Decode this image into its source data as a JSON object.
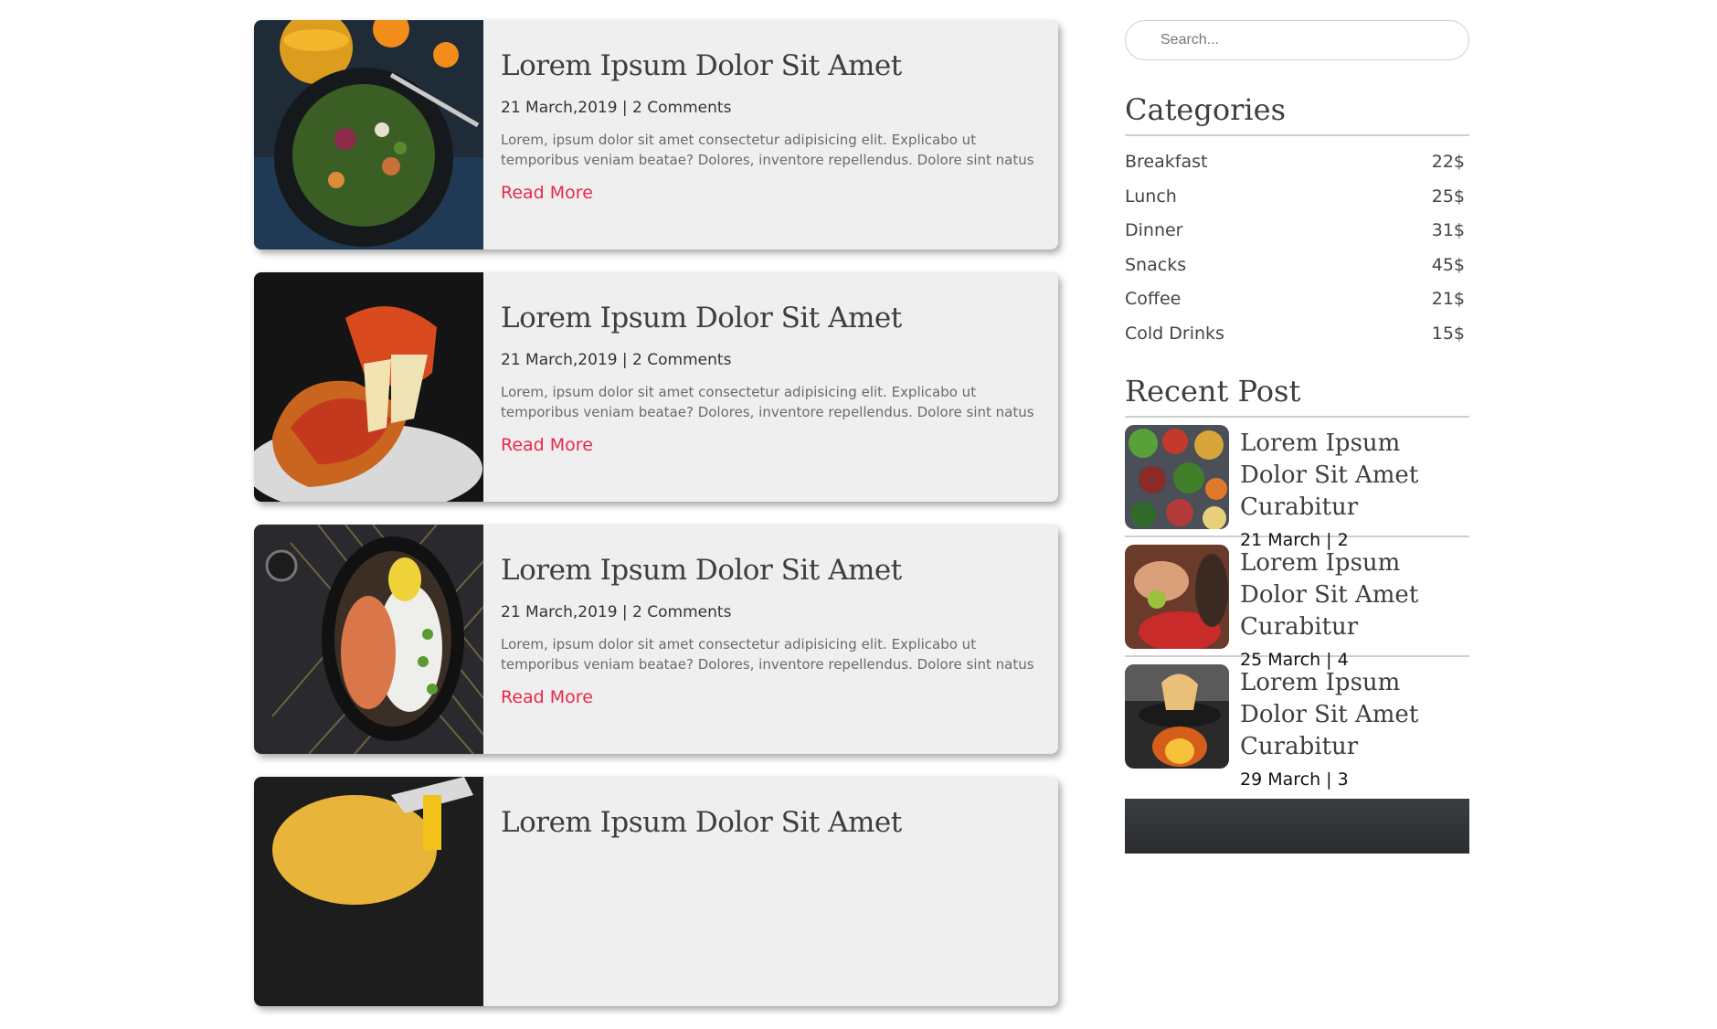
{
  "search": {
    "placeholder": "Search..."
  },
  "posts": [
    {
      "title": "Lorem Ipsum Dolor Sit Amet",
      "meta": "21 March,2019 | 2 Comments",
      "excerpt": "Lorem, ipsum dolor sit amet consectetur adipisicing elit. Explicabo ut temporibus veniam beatae? Dolores, inventore repellendus. Dolore sint natus",
      "read_more": "Read More",
      "image": "salad-photo"
    },
    {
      "title": "Lorem Ipsum Dolor Sit Amet",
      "meta": "21 March,2019 | 2 Comments",
      "excerpt": "Lorem, ipsum dolor sit amet consectetur adipisicing elit. Explicabo ut temporibus veniam beatae? Dolores, inventore repellendus. Dolore sint natus",
      "read_more": "Read More",
      "image": "pizza-photo"
    },
    {
      "title": "Lorem Ipsum Dolor Sit Amet",
      "meta": "21 March,2019 | 2 Comments",
      "excerpt": "Lorem, ipsum dolor sit amet consectetur adipisicing elit. Explicabo ut temporibus veniam beatae? Dolores, inventore repellendus. Dolore sint natus",
      "read_more": "Read More",
      "image": "shrimp-rice-bowl-photo"
    },
    {
      "title": "Lorem Ipsum Dolor Sit Amet",
      "image": "pasta-photo"
    }
  ],
  "categories": {
    "heading": "Categories",
    "items": [
      {
        "name": "Breakfast",
        "price": "22$"
      },
      {
        "name": "Lunch",
        "price": "25$"
      },
      {
        "name": "Dinner",
        "price": "31$"
      },
      {
        "name": "Snacks",
        "price": "45$"
      },
      {
        "name": "Coffee",
        "price": "21$"
      },
      {
        "name": "Cold Drinks",
        "price": "15$"
      }
    ]
  },
  "recent": {
    "heading": "Recent Post",
    "items": [
      {
        "title": "Lorem Ipsum Dolor Sit Amet Curabitur",
        "meta": "21 March | 2",
        "image": "vegetables-photo"
      },
      {
        "title": "Lorem Ipsum Dolor Sit Amet Curabitur",
        "meta": "25 March | 4",
        "image": "cooking-hands-photo"
      },
      {
        "title": "Lorem Ipsum Dolor Sit Amet Curabitur",
        "meta": "29 March | 3",
        "image": "wok-noodles-photo"
      }
    ]
  },
  "colors": {
    "accent": "#e8294a",
    "card_bg": "#efefef",
    "divider": "#cfcfcf"
  }
}
